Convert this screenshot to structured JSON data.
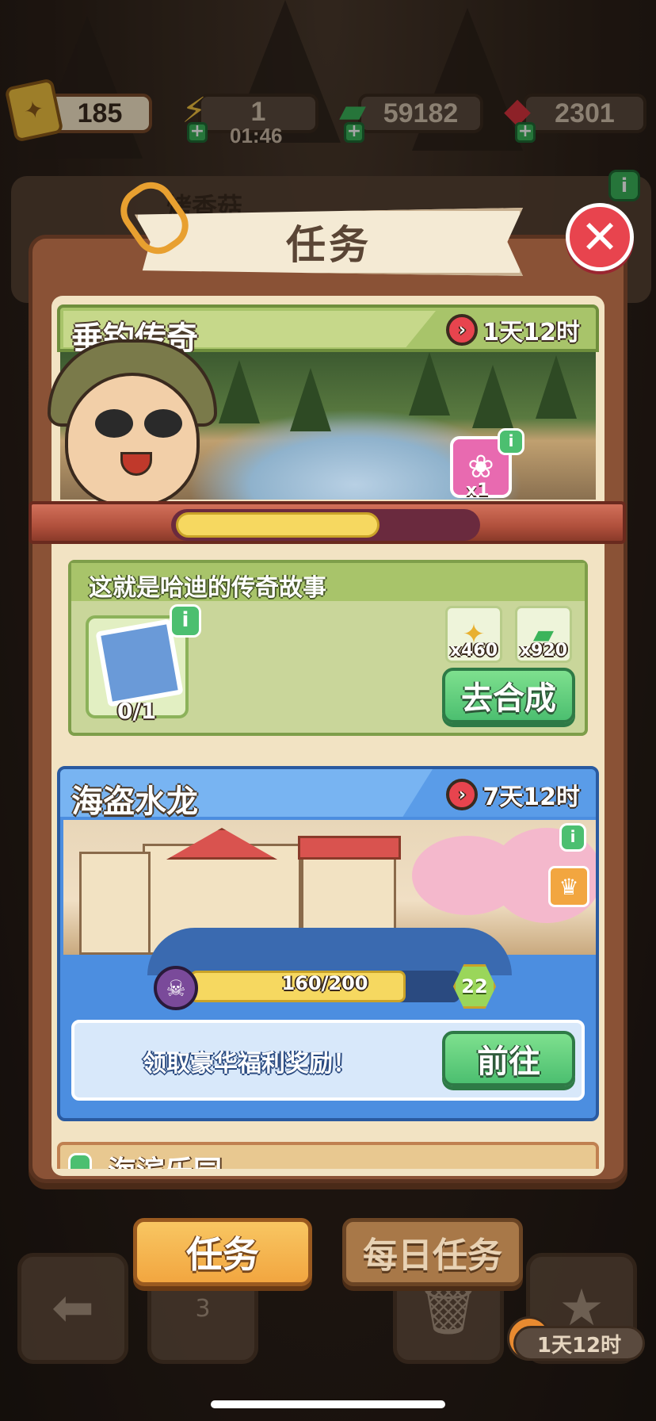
{
  "resources": {
    "tickets": "185",
    "energy": "1",
    "energy_timer": "01:46",
    "cash": "59182",
    "gems": "2301"
  },
  "behind": {
    "title": "烤香菇"
  },
  "panel": {
    "title": "任务"
  },
  "quest1": {
    "title": "垂钓传奇",
    "timer": "1天12时",
    "gift_count": "x1",
    "progress_fraction": 0.68,
    "subtitle": "这就是哈迪的传奇故事",
    "item_count": "0/1",
    "rewards": [
      {
        "icon": "ticket-icon",
        "count": "x460"
      },
      {
        "icon": "cash-icon",
        "count": "x920"
      }
    ],
    "button": "去合成"
  },
  "quest2": {
    "title": "海盗水龙",
    "timer": "7天12时",
    "progress": "160/200",
    "progress_fraction": 0.8,
    "level": "22",
    "message": "领取豪华福利奖励！",
    "button": "前往"
  },
  "quest3": {
    "title": "海滨乐园"
  },
  "tabs": {
    "tasks": "任务",
    "daily": "每日任务"
  },
  "bottom": {
    "nav_badge": "3",
    "timer": "1天12时"
  },
  "colors": {
    "panel_brown": "#8a5236",
    "quest1_green": "#a8c46a",
    "quest2_blue": "#4c8ee0",
    "button_green": "#4cbf70",
    "tab_active": "#f2a640",
    "close_red": "#e8444e"
  }
}
